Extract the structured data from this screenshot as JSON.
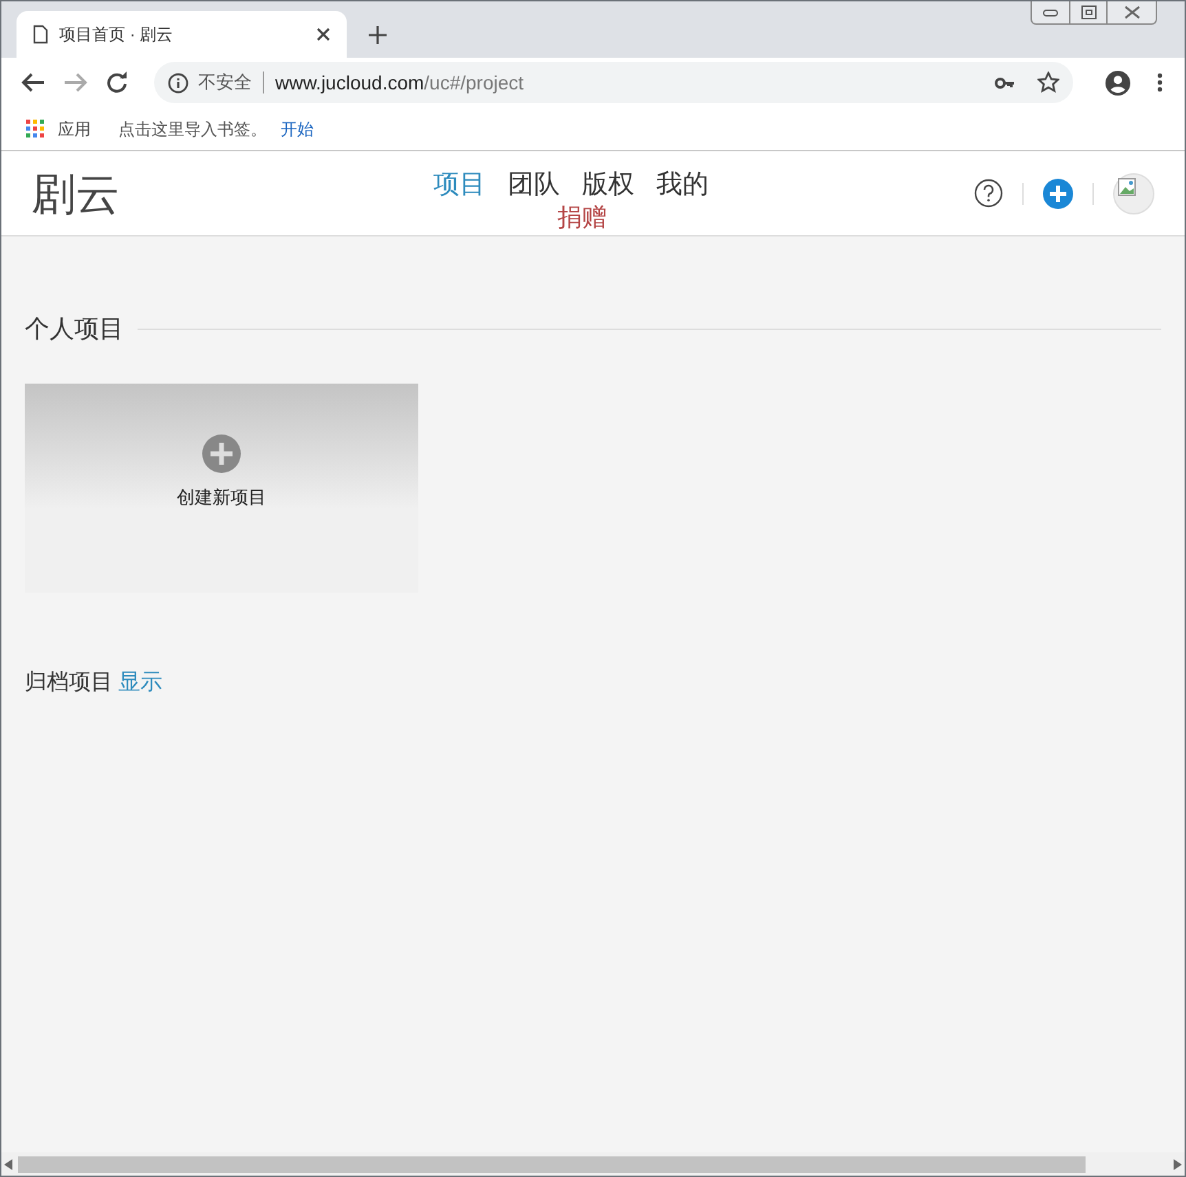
{
  "browser": {
    "tab": {
      "title": "项目首页 · 剧云"
    },
    "address": {
      "security": "不安全",
      "host": "www.jucloud.com",
      "path": "/uc#/project"
    },
    "bookmarks": [
      {
        "kind": "apps",
        "label": "应用"
      },
      {
        "kind": "text",
        "label": "点击这里导入书签。"
      },
      {
        "kind": "link",
        "label": "开始"
      }
    ]
  },
  "header": {
    "logo": "剧云",
    "nav": [
      {
        "label": "项目",
        "selected": true
      },
      {
        "label": "团队",
        "selected": false
      },
      {
        "label": "版权",
        "selected": false
      },
      {
        "label": "我的",
        "selected": false
      }
    ],
    "donate": "捐赠"
  },
  "personal": {
    "heading": "个人项目",
    "create_card": {
      "label": "创建新项目"
    }
  },
  "archive": {
    "label": "归档项目",
    "action": "显示"
  }
}
